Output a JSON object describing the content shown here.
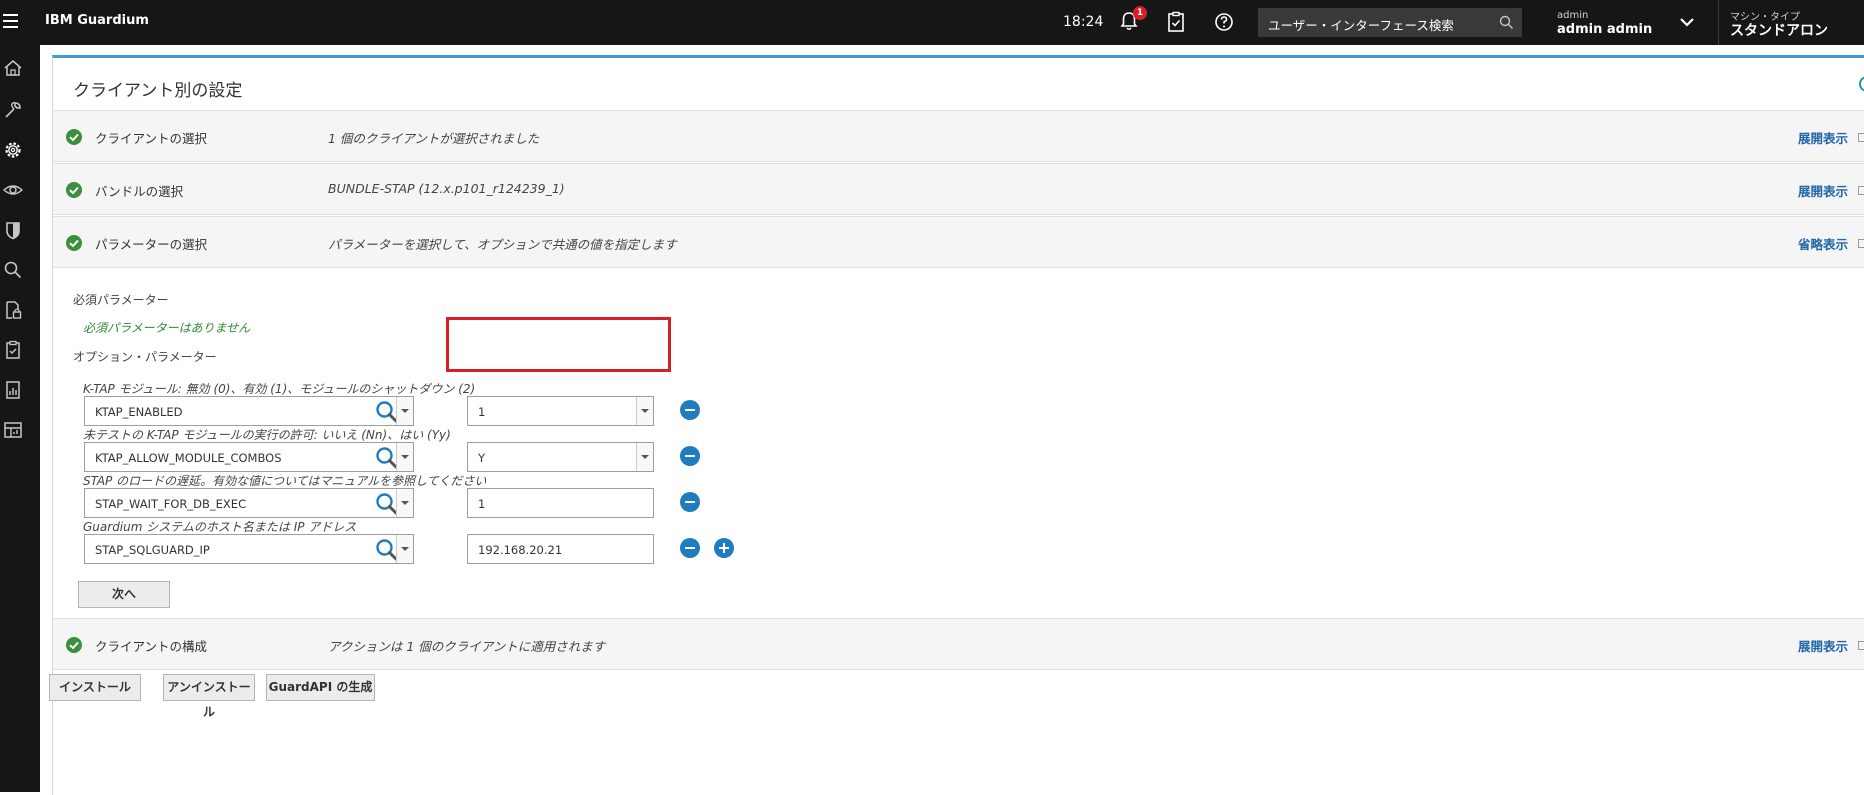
{
  "topbar": {
    "brand": "IBM Guardium",
    "time": "18:24",
    "notification_count": "1",
    "search_placeholder": "ユーザー・インターフェース検索",
    "user_label": "admin",
    "user_name": "admin admin",
    "machine_type_label": "マシン・タイプ",
    "machine_type_value": "スタンドアロン"
  },
  "sidenav": {
    "icons": [
      "home-icon",
      "wrench-icon",
      "gear-icon",
      "eye-icon",
      "shield-icon",
      "search-icon",
      "document-lock-icon",
      "clipboard-check-icon",
      "report-icon",
      "dashboard-icon"
    ]
  },
  "panel": {
    "title": "クライアント別の設定",
    "steps": [
      {
        "name": "クライアントの選択",
        "desc": "1 個のクライアントが選択されました",
        "link": "展開表示"
      },
      {
        "name": "バンドルの選択",
        "desc": "BUNDLE-STAP (12.x.p101_r124239_1)",
        "link": "展開表示"
      },
      {
        "name": "パラメーターの選択",
        "desc": "パラメーターを選択して、オプションで共通の値を指定します",
        "link": "省略表示"
      },
      {
        "name": "クライアントの構成",
        "desc": "アクションは 1 個のクライアントに適用されます",
        "link": "展開表示"
      }
    ],
    "required_label": "必須パラメーター",
    "required_none": "必須パラメーターはありません",
    "optional_label": "オプション・パラメーター",
    "params": [
      {
        "desc": "K-TAP モジュール: 無効 (0)、有効 (1)、モジュールのシャットダウン (2)",
        "name": "KTAP_ENABLED",
        "value": "1"
      },
      {
        "desc": "未テストの K-TAP モジュールの実行の許可: いいえ (Nn)、はい (Yy)",
        "name": "KTAP_ALLOW_MODULE_COMBOS",
        "value": "Y"
      },
      {
        "desc": "STAP のロードの遅延。有効な値についてはマニュアルを参照してください",
        "name": "STAP_WAIT_FOR_DB_EXEC",
        "value": "1"
      },
      {
        "desc": "Guardium システムのホスト名または IP アドレス",
        "name": "STAP_SQLGUARD_IP",
        "value": "192.168.20.21"
      }
    ],
    "next_button": "次へ"
  },
  "actions": {
    "install": "インストール",
    "uninstall": "アンインストール",
    "guardapi": "GuardAPI の生成"
  },
  "colors": {
    "topbar_bg": "#161616",
    "accent_blue": "#1f7cc0",
    "link_blue": "#2066a8",
    "check_green": "#3c8f3e",
    "highlight_red": "#da1e28"
  }
}
